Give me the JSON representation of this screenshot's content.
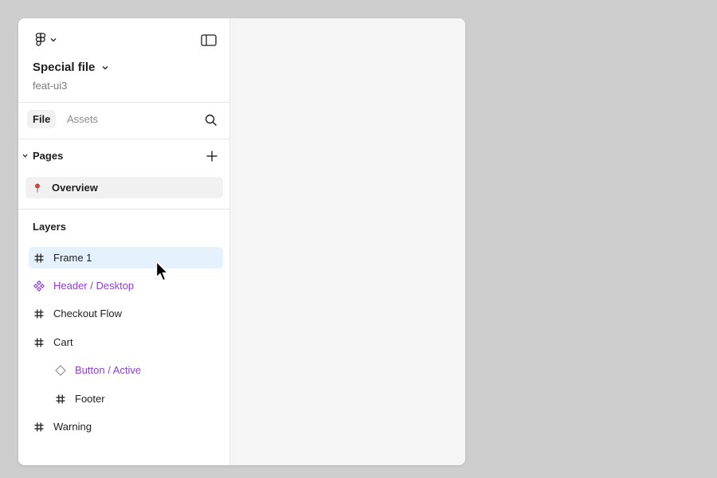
{
  "header": {
    "file_name": "Special file",
    "branch": "feat-ui3"
  },
  "tabs": [
    {
      "label": "File",
      "active": true
    },
    {
      "label": "Assets",
      "active": false
    }
  ],
  "pages": {
    "title": "Pages",
    "items": [
      {
        "label": "Overview",
        "icon": "pin-icon",
        "selected": true
      }
    ]
  },
  "layers": {
    "title": "Layers",
    "items": [
      {
        "label": "Frame 1",
        "icon": "frame-icon",
        "indent": 0,
        "selected": true
      },
      {
        "label": "Header / Desktop",
        "icon": "component-icon",
        "indent": 0,
        "selected": false,
        "color": "#8e3ed9"
      },
      {
        "label": "Checkout Flow",
        "icon": "frame-icon",
        "indent": 0,
        "selected": false
      },
      {
        "label": "Cart",
        "icon": "frame-icon",
        "indent": 0,
        "selected": false
      },
      {
        "label": "Button / Active",
        "icon": "instance-icon",
        "indent": 1,
        "selected": false,
        "color": "#8e3ed9"
      },
      {
        "label": "Footer",
        "icon": "frame-icon",
        "indent": 1,
        "selected": false
      },
      {
        "label": "Warning",
        "icon": "frame-icon",
        "indent": 0,
        "selected": false
      }
    ]
  },
  "colors": {
    "accent_purple": "#8e3ed9",
    "selection_blue": "#e5f1fd",
    "background": "#cecece",
    "pin_red": "#e03e2d"
  }
}
